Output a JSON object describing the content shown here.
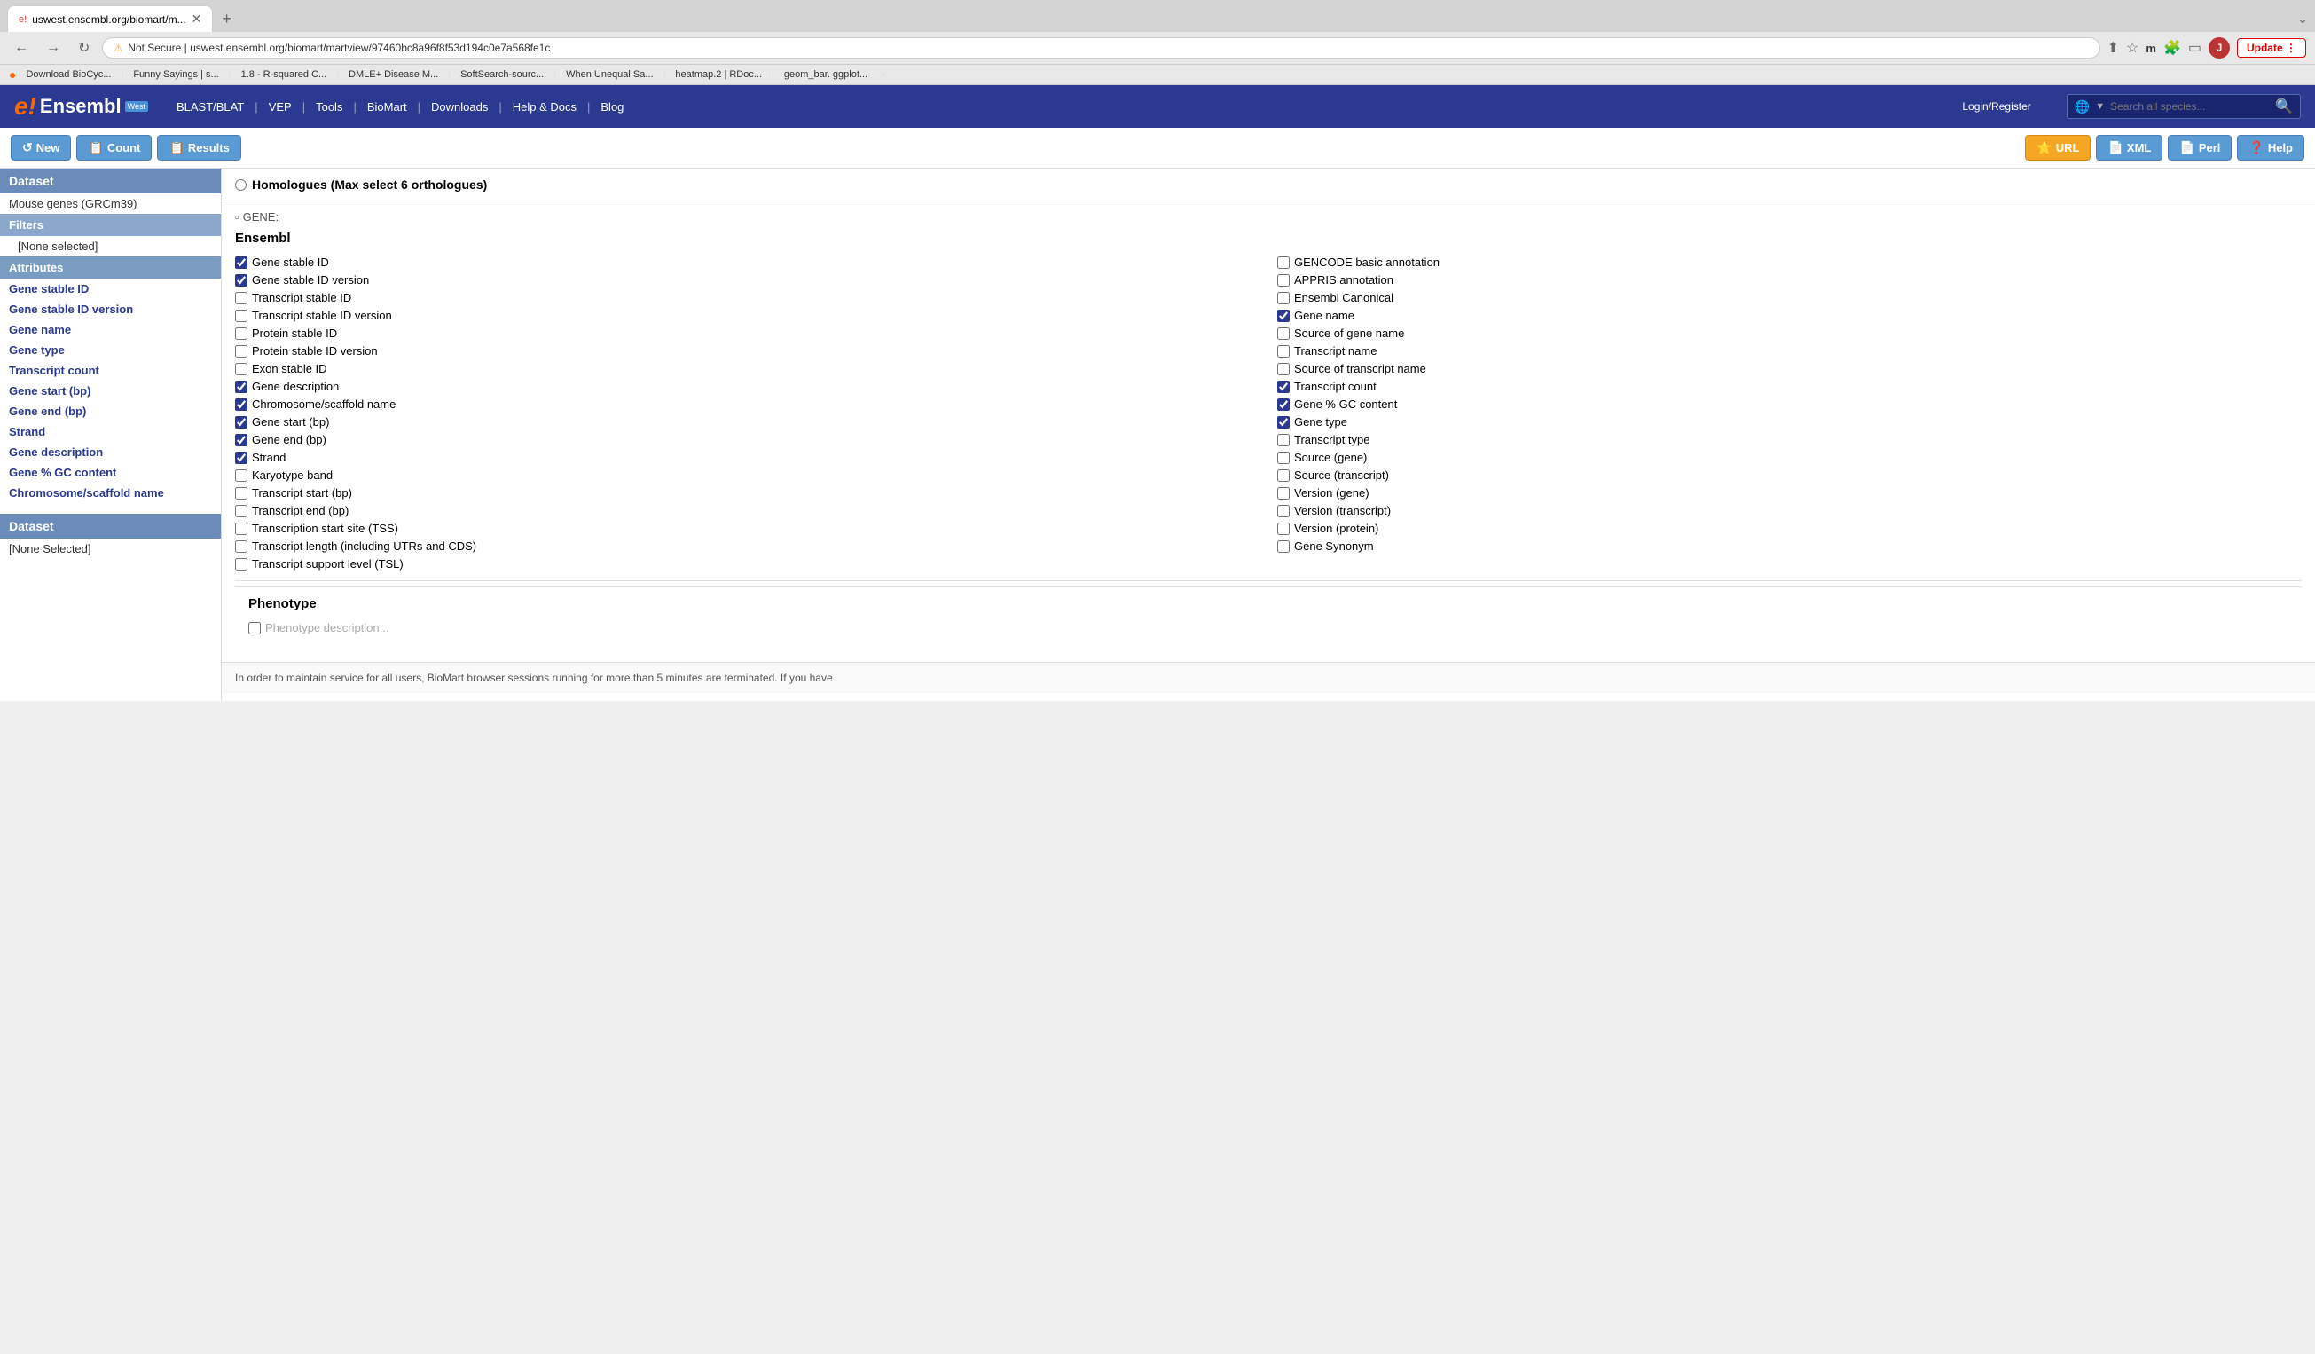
{
  "browser": {
    "tab_title": "uswest.ensembl.org/biomart/m...",
    "url": "uswest.ensembl.org/biomart/martview/97460bc8a96f8f53d194c0e7a568fe1c",
    "url_full": "Not Secure | uswest.ensembl.org/biomart/martview/97460bc8a96f8f53d194c0e7a568fe1c",
    "bookmarks": [
      {
        "label": "Download BioCyc..."
      },
      {
        "label": "Funny Sayings | s..."
      },
      {
        "label": "1.8 - R-squared C..."
      },
      {
        "label": "DMLE+ Disease M..."
      },
      {
        "label": "SoftSearch-sourc..."
      },
      {
        "label": "When Unequal Sa..."
      },
      {
        "label": "heatmap.2 | RDoc..."
      },
      {
        "label": "geom_bar. ggplot..."
      }
    ],
    "user_initial": "J"
  },
  "ensembl": {
    "logo_e": "e!",
    "logo_text": "Ensembl",
    "logo_west": "West",
    "nav_items": [
      "BLAST/BLAT",
      "VEP",
      "Tools",
      "BioMart",
      "Downloads",
      "Help & Docs",
      "Blog"
    ],
    "search_placeholder": "Search all species...",
    "login_register": "Login/Register"
  },
  "toolbar": {
    "new_label": "New",
    "count_label": "Count",
    "results_label": "Results",
    "url_label": "URL",
    "xml_label": "XML",
    "perl_label": "Perl",
    "help_label": "Help"
  },
  "sidebar": {
    "dataset_label": "Dataset",
    "dataset_value": "Mouse genes (GRCm39)",
    "filters_label": "Filters",
    "filters_value": "[None selected]",
    "attributes_label": "Attributes",
    "attribute_items": [
      "Gene stable ID",
      "Gene stable ID version",
      "Gene name",
      "Gene type",
      "Transcript count",
      "Gene start (bp)",
      "Gene end (bp)",
      "Strand",
      "Gene description",
      "Gene % GC content",
      "Chromosome/scaffold name"
    ],
    "dataset2_label": "Dataset",
    "dataset2_value": "[None Selected]"
  },
  "content": {
    "homologues_title": "Homologues (Max select 6 orthologues)",
    "gene_header": "GENE:",
    "ensembl_section": "Ensembl",
    "left_checkboxes": [
      {
        "label": "Gene stable ID",
        "checked": true
      },
      {
        "label": "Gene stable ID version",
        "checked": true
      },
      {
        "label": "Transcript stable ID",
        "checked": false
      },
      {
        "label": "Transcript stable ID version",
        "checked": false
      },
      {
        "label": "Protein stable ID",
        "checked": false
      },
      {
        "label": "Protein stable ID version",
        "checked": false
      },
      {
        "label": "Exon stable ID",
        "checked": false
      },
      {
        "label": "Gene description",
        "checked": true
      },
      {
        "label": "Chromosome/scaffold name",
        "checked": true
      },
      {
        "label": "Gene start (bp)",
        "checked": true
      },
      {
        "label": "Gene end (bp)",
        "checked": true
      },
      {
        "label": "Strand",
        "checked": true
      },
      {
        "label": "Karyotype band",
        "checked": false
      },
      {
        "label": "Transcript start (bp)",
        "checked": false
      },
      {
        "label": "Transcript end (bp)",
        "checked": false
      },
      {
        "label": "Transcription start site (TSS)",
        "checked": false
      },
      {
        "label": "Transcript length (including UTRs and CDS)",
        "checked": false
      },
      {
        "label": "Transcript support level (TSL)",
        "checked": false
      }
    ],
    "right_checkboxes": [
      {
        "label": "GENCODE basic annotation",
        "checked": false
      },
      {
        "label": "APPRIS annotation",
        "checked": false
      },
      {
        "label": "Ensembl Canonical",
        "checked": false
      },
      {
        "label": "Gene name",
        "checked": true
      },
      {
        "label": "Source of gene name",
        "checked": false
      },
      {
        "label": "Transcript name",
        "checked": false
      },
      {
        "label": "Source of transcript name",
        "checked": false
      },
      {
        "label": "Transcript count",
        "checked": true
      },
      {
        "label": "Gene % GC content",
        "checked": true
      },
      {
        "label": "Gene type",
        "checked": true
      },
      {
        "label": "Transcript type",
        "checked": false
      },
      {
        "label": "Source (gene)",
        "checked": false
      },
      {
        "label": "Source (transcript)",
        "checked": false
      },
      {
        "label": "Version (gene)",
        "checked": false
      },
      {
        "label": "Version (transcript)",
        "checked": false
      },
      {
        "label": "Version (protein)",
        "checked": false
      },
      {
        "label": "Gene Synonym",
        "checked": false
      }
    ],
    "phenotype_section": "Phenotype",
    "bottom_notice": "In order to maintain service for all users, BioMart browser sessions running for more than 5 minutes are terminated. If you have"
  }
}
